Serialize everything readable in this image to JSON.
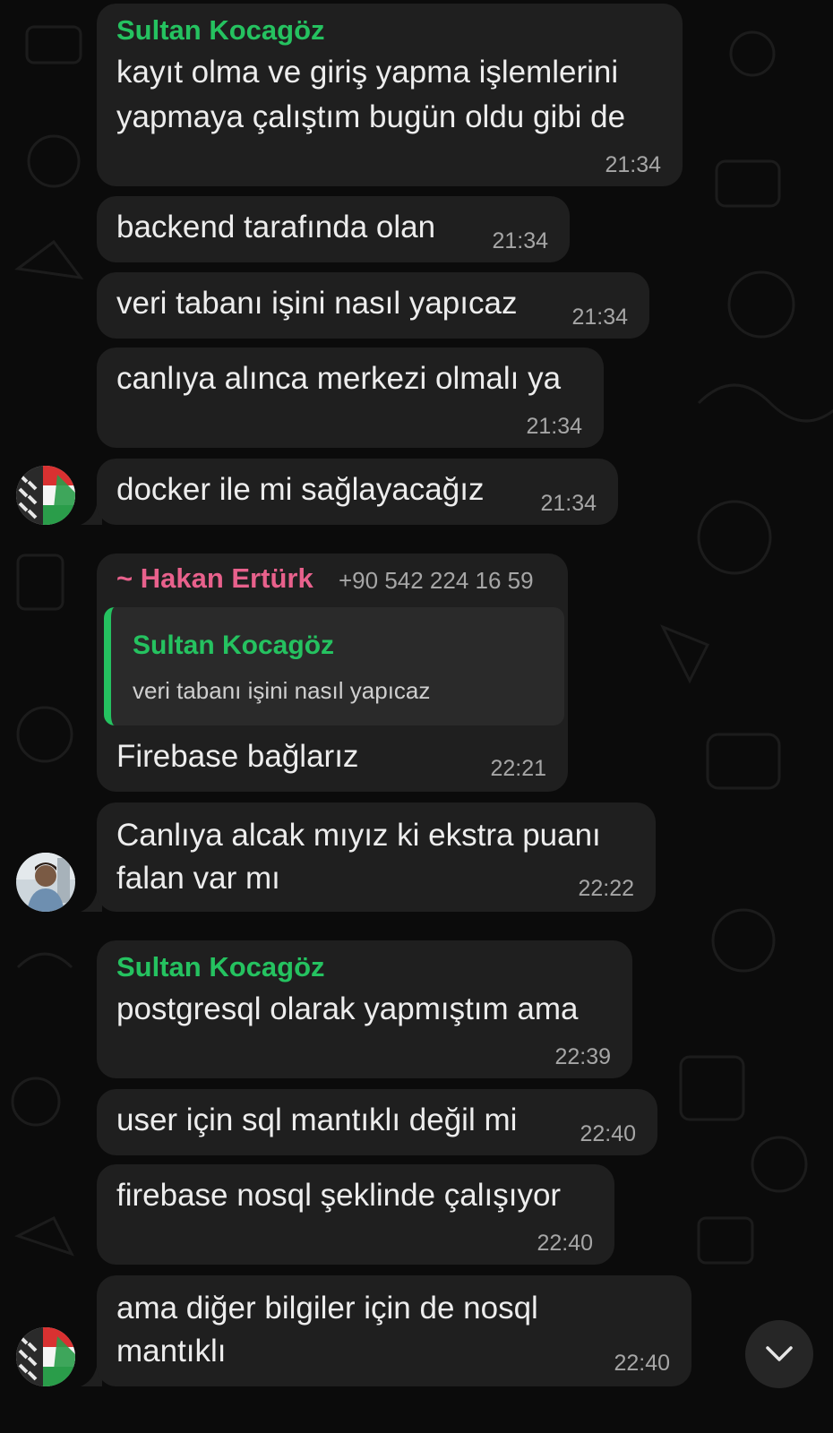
{
  "chat": {
    "scroll_down_icon": "chevron-down-icon",
    "colors": {
      "background": "#0b0b0b",
      "bubble": "#1f1f1f",
      "sender_green": "#25c260",
      "sender_pink": "#e8618c"
    },
    "messages": [
      {
        "sender": "Sultan Kocagöz",
        "lines": [
          "kayıt olma ve giriş yapma işlemlerini",
          "yapmaya çalıştım bugün oldu gibi de"
        ],
        "time": "21:34"
      },
      {
        "lines": [
          "backend tarafında olan"
        ],
        "time": "21:34"
      },
      {
        "lines": [
          "veri tabanı işini nasıl yapıcaz"
        ],
        "time": "21:34"
      },
      {
        "lines": [
          "canlıya alınca merkezi olmalı ya"
        ],
        "time": "21:34"
      },
      {
        "lines": [
          "docker ile mi sağlayacağız"
        ],
        "time": "21:34"
      },
      {
        "sender": "~ Hakan Ertürk",
        "phone": "+90 542 224 16 59",
        "reply": {
          "sender": "Sultan Kocagöz",
          "text": "veri tabanı işini nasıl yapıcaz"
        },
        "lines": [
          "Firebase bağlarız"
        ],
        "time": "22:21"
      },
      {
        "lines": [
          "Canlıya alcak mıyız ki ekstra puanı",
          "falan var mı"
        ],
        "time": "22:22"
      },
      {
        "sender": "Sultan Kocagöz",
        "lines": [
          "postgresql olarak yapmıştım ama"
        ],
        "time": "22:39"
      },
      {
        "lines": [
          "user için sql mantıklı değil mi"
        ],
        "time": "22:40"
      },
      {
        "lines": [
          "firebase nosql şeklinde çalışıyor"
        ],
        "time": "22:40"
      },
      {
        "lines": [
          "ama diğer bilgiler için de nosql",
          "mantıklı"
        ],
        "time": "22:40"
      }
    ]
  }
}
